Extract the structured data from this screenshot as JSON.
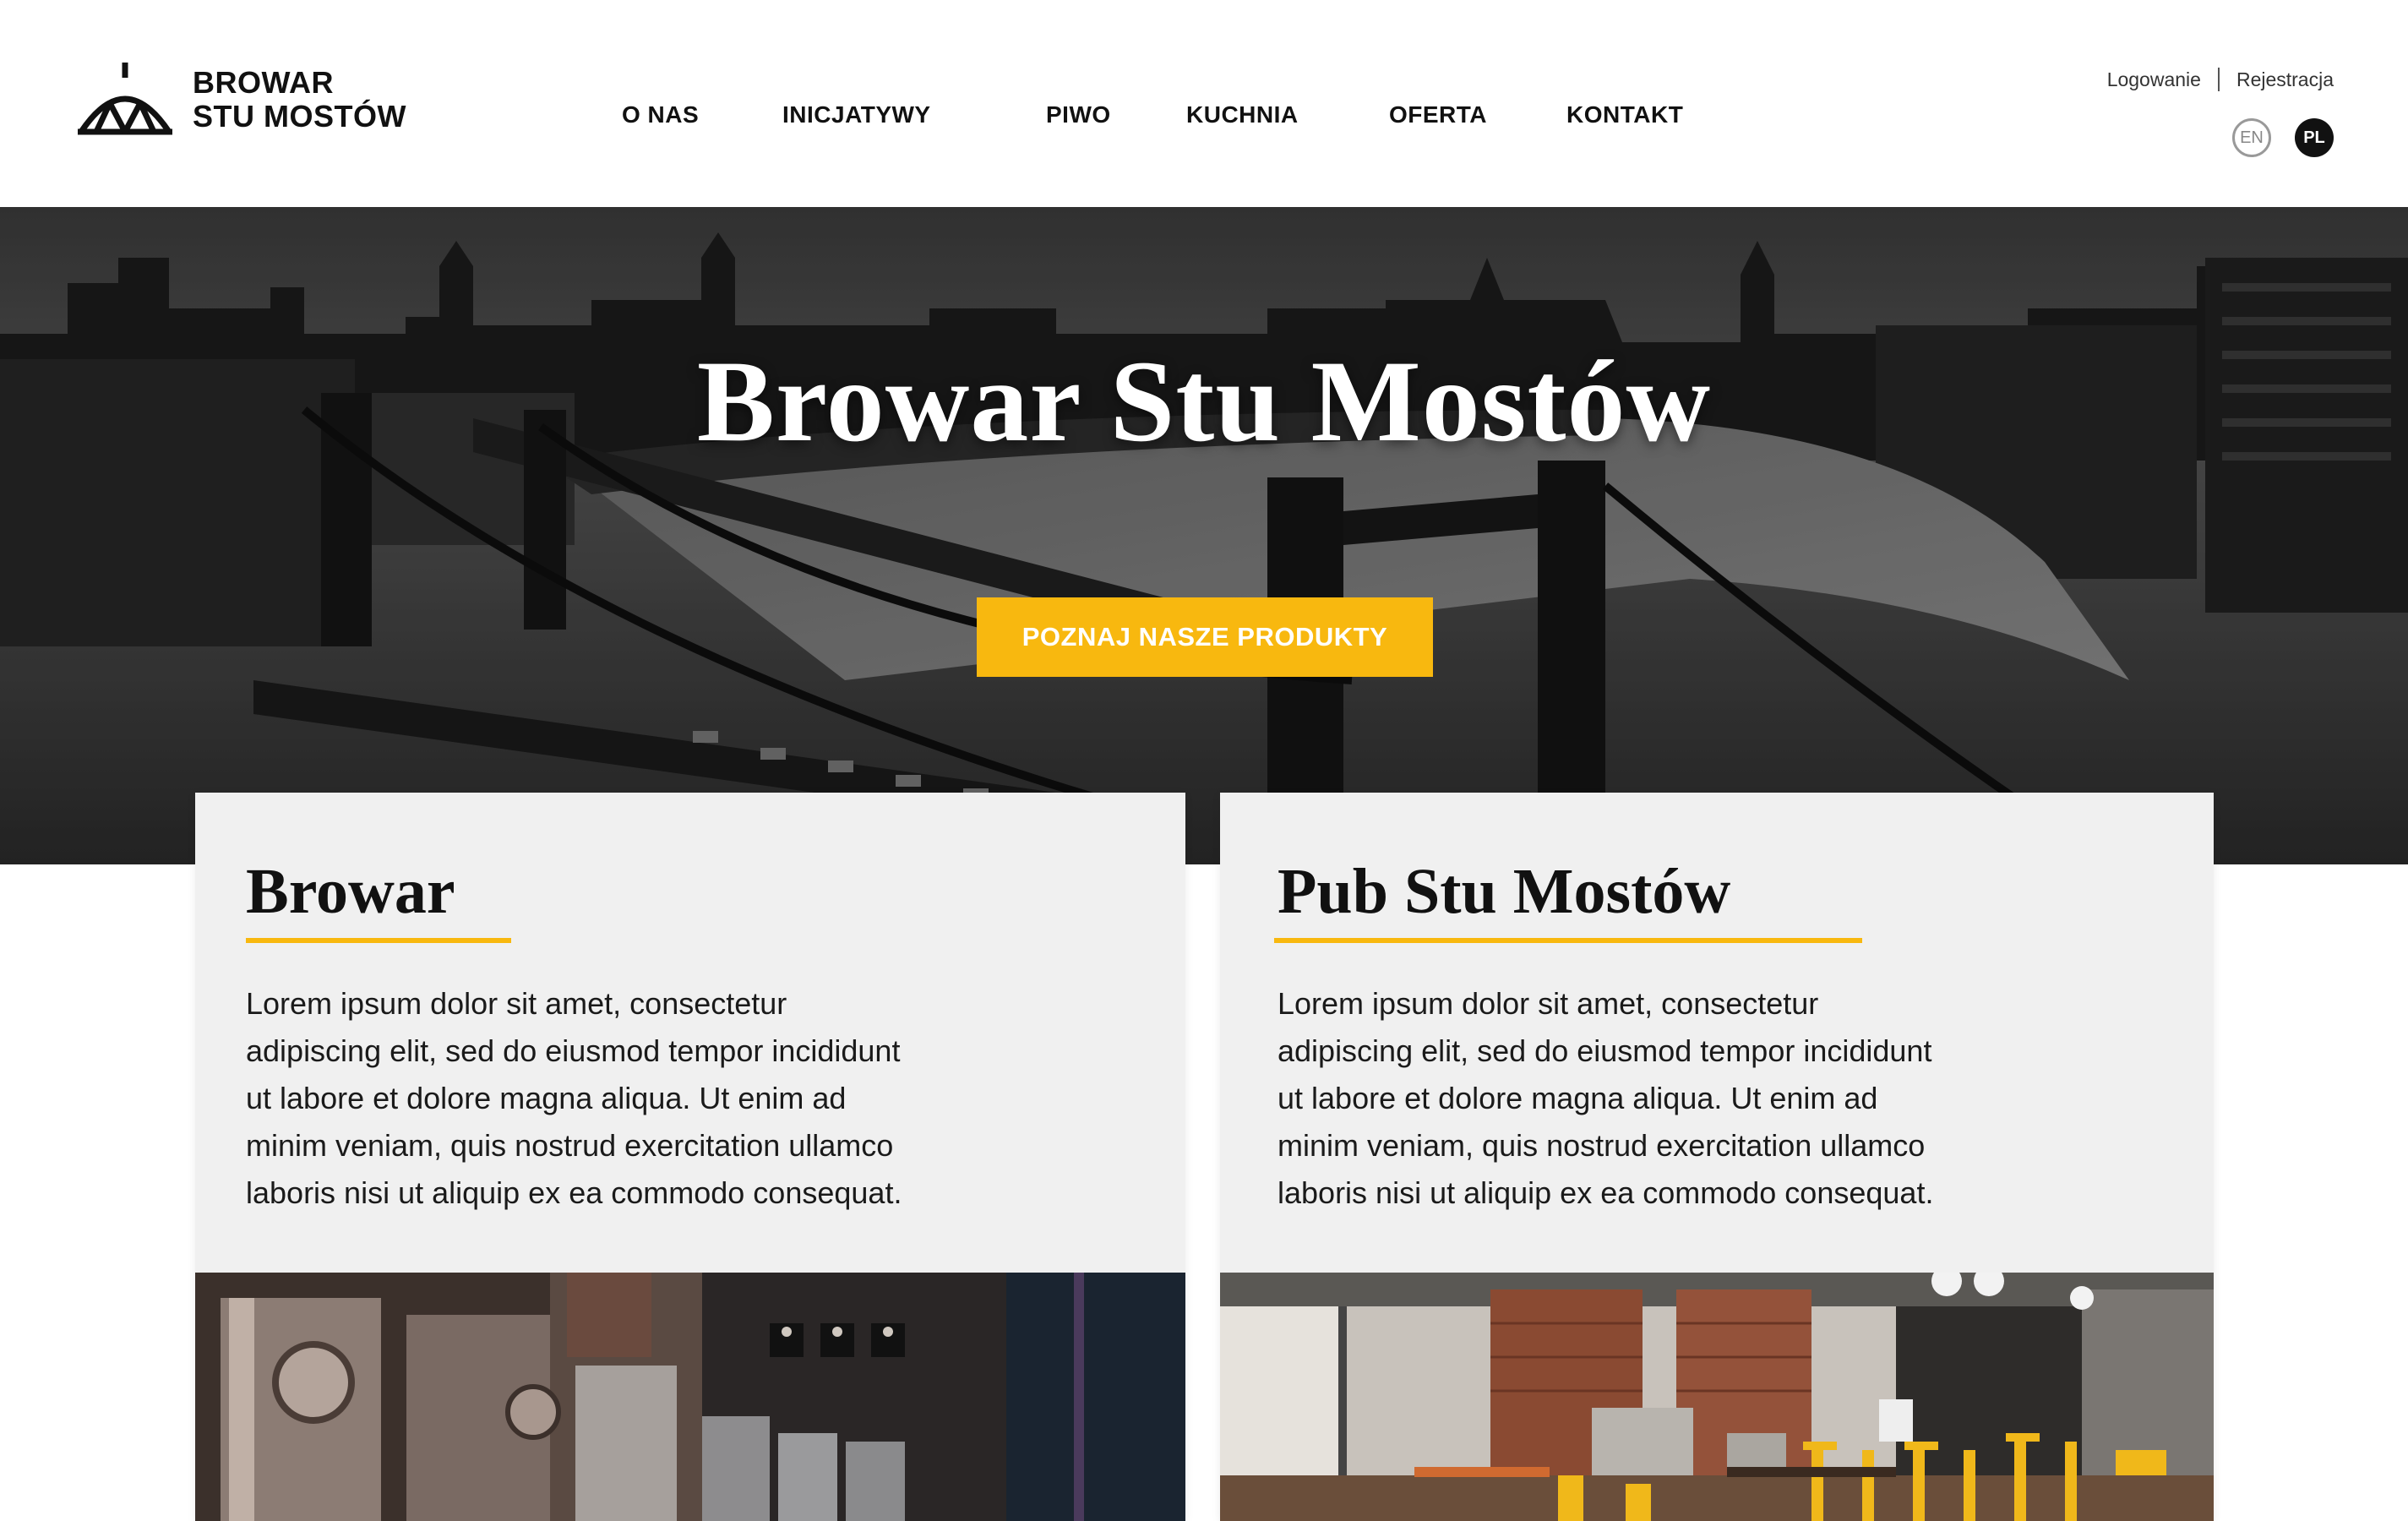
{
  "header": {
    "logo": {
      "line1": "BROWAR",
      "line2": "STU MOSTÓW",
      "icon": "bridge-logo-icon"
    },
    "nav": [
      "O NAS",
      "INICJATYWY",
      "PIWO",
      "KUCHNIA",
      "OFERTA",
      "KONTAKT"
    ],
    "auth": {
      "login": "Logowanie",
      "register": "Rejestracja"
    },
    "languages": {
      "en": "EN",
      "pl": "PL",
      "active": "PL"
    }
  },
  "hero": {
    "title": "Browar Stu Mostów",
    "cta": "POZNAJ NASZE PRODUKTY"
  },
  "cards": [
    {
      "title": "Browar",
      "text": "Lorem ipsum dolor sit amet, consectetur adipiscing elit, sed do eiusmod tempor incididunt ut labore et dolore magna aliqua. Ut enim ad minim veniam, quis nostrud exercitation ullamco laboris nisi ut aliquip ex ea commodo consequat."
    },
    {
      "title": "Pub Stu Mostów",
      "text": "Lorem ipsum dolor sit amet, consectetur adipiscing elit, sed do eiusmod tempor incididunt ut labore et dolore magna aliqua. Ut enim ad minim veniam, quis nostrud exercitation ullamco laboris nisi ut aliquip ex ea commodo consequat."
    }
  ],
  "colors": {
    "accent": "#f8b80f",
    "text": "#111111",
    "card_bg": "#f0f0f0"
  }
}
